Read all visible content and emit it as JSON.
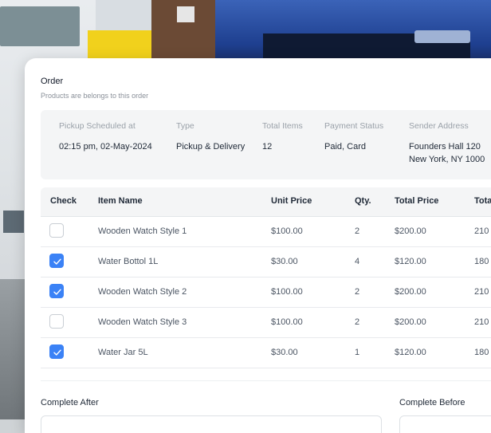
{
  "order": {
    "title": "Order",
    "subtitle": "Products are belongs to this order"
  },
  "summary": {
    "pickup_label": "Pickup Scheduled at",
    "pickup_value": "02:15 pm, 02-May-2024",
    "type_label": "Type",
    "type_value": "Pickup & Delivery",
    "total_items_label": "Total Items",
    "total_items_value": "12",
    "payment_label": "Payment Status",
    "payment_value": "Paid, Card",
    "sender_label": "Sender Address",
    "sender_line1": "Founders Hall 120",
    "sender_line2": "New York, NY 1000"
  },
  "table": {
    "headers": {
      "check": "Check",
      "item_name": "Item Name",
      "unit_price": "Unit Price",
      "qty": "Qty.",
      "total_price": "Total Price",
      "total_extra": "Tota"
    },
    "rows": [
      {
        "checked": false,
        "item": "Wooden Watch Style 1",
        "unit_price": "$100.00",
        "qty": "2",
        "total": "$200.00",
        "extra": "210"
      },
      {
        "checked": true,
        "item": "Water Bottol 1L",
        "unit_price": "$30.00",
        "qty": "4",
        "total": "$120.00",
        "extra": "180"
      },
      {
        "checked": true,
        "item": "Wooden Watch  Style 2",
        "unit_price": "$100.00",
        "qty": "2",
        "total": "$200.00",
        "extra": "210"
      },
      {
        "checked": false,
        "item": "Wooden Watch  Style 3",
        "unit_price": "$100.00",
        "qty": "2",
        "total": "$200.00",
        "extra": "210"
      },
      {
        "checked": true,
        "item": "Water Jar 5L",
        "unit_price": "$30.00",
        "qty": "1",
        "total": "$120.00",
        "extra": "180"
      }
    ]
  },
  "fields": {
    "complete_after_label": "Complete After",
    "complete_before_label": "Complete Before"
  },
  "colors": {
    "accent": "#3b82f6",
    "card_bg": "#ffffff",
    "panel_bg": "#f4f5f6"
  },
  "icons": {
    "checkbox_check": "check-icon"
  }
}
